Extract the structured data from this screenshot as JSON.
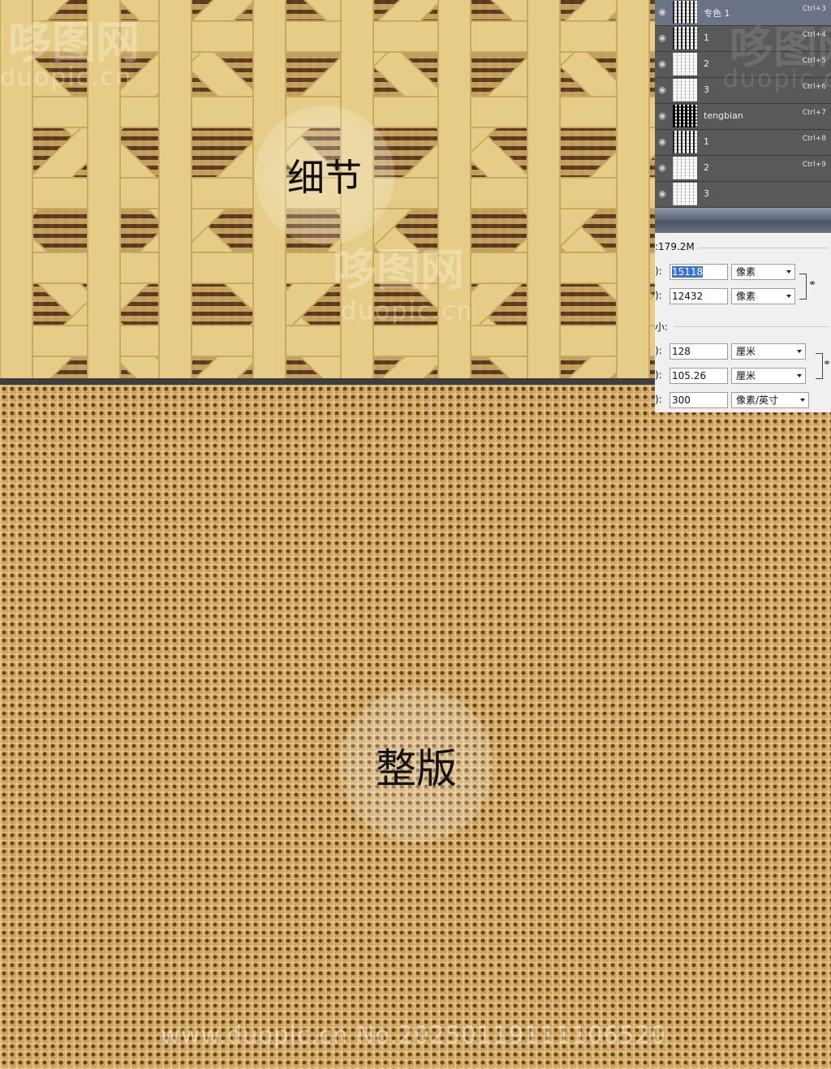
{
  "detail": {
    "label": "细节",
    "watermark_cn": "哆图网",
    "watermark_en": "duopic.cn"
  },
  "plate": {
    "label": "整版",
    "footer_watermark": "www.duopic.cn No.20250119111106520"
  },
  "layers_panel": {
    "layers": [
      {
        "name": "专色 1",
        "shortcut": "Ctrl+3",
        "thumb": "medium",
        "active": true
      },
      {
        "name": "1",
        "shortcut": "Ctrl+4",
        "thumb": "medium",
        "active": false
      },
      {
        "name": "2",
        "shortcut": "Ctrl+5",
        "thumb": "light",
        "active": false
      },
      {
        "name": "3",
        "shortcut": "Ctrl+6",
        "thumb": "light",
        "active": false
      },
      {
        "name": "tengbian",
        "shortcut": "Ctrl+7",
        "thumb": "dark",
        "active": false
      },
      {
        "name": "1",
        "shortcut": "Ctrl+8",
        "thumb": "medium",
        "active": false
      },
      {
        "name": "2",
        "shortcut": "Ctrl+9",
        "thumb": "light",
        "active": false
      },
      {
        "name": "3",
        "shortcut": "",
        "thumb": "light",
        "active": false
      }
    ],
    "watermark_cn": "哆图网",
    "watermark_en": "duopic.cn"
  },
  "image_size_dialog": {
    "pixel_size": ":179.2M",
    "width_prefix": "):",
    "width_value": "15118",
    "width_unit": "像素",
    "height_prefix": "):",
    "height_value": "12432",
    "height_unit": "像素",
    "doc_size_label": "小:",
    "doc_width_prefix": "):",
    "doc_width_value": "128",
    "doc_width_unit": "厘米",
    "doc_height_prefix": "):",
    "doc_height_value": "105.26",
    "doc_height_unit": "厘米",
    "resolution_prefix": "):",
    "resolution_value": "300",
    "resolution_unit": "像素/英寸"
  },
  "colors": {
    "rattan_strip": "#e6cd87",
    "rattan_strip_shadow": "#c9a95e",
    "weave_brown": "#6e4a2c",
    "plate_base": "#cfa764",
    "panel_bg": "#535353",
    "active_layer": "#6b7487",
    "selection_blue": "#3874d8"
  }
}
